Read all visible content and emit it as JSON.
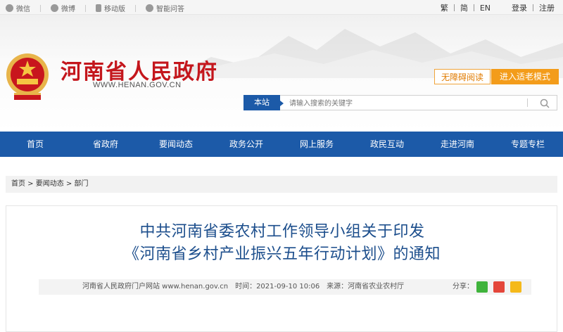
{
  "topbar": {
    "links": [
      "微信",
      "微博",
      "移动版",
      "智能问答"
    ],
    "lang": [
      "繁",
      "简",
      "EN"
    ],
    "login": "登录",
    "register": "注册"
  },
  "header": {
    "title": "河南省人民政府",
    "url": "WWW.HENAN.GOV.CN",
    "accessible": "无障碍阅读",
    "elder_mode": "进入适老模式"
  },
  "search": {
    "scope": "本站",
    "placeholder": "请输入搜索的关键字"
  },
  "nav": [
    "首页",
    "省政府",
    "要闻动态",
    "政务公开",
    "网上服务",
    "政民互动",
    "走进河南",
    "专题专栏"
  ],
  "breadcrumb": "首页 > 要闻动态 > 部门",
  "article": {
    "title_line1": "中共河南省委农村工作领导小组关于印发",
    "title_line2": "《河南省乡村产业振兴五年行动计划》的通知",
    "meta": "河南省人民政府门户网站 www.henan.gov.cn　时间：2021-09-10 10:06　来源：河南省农业农村厅",
    "share_label": "分享：",
    "share_icons": [
      "wechat-icon",
      "weibo-icon",
      "qzone-icon"
    ]
  },
  "colors": {
    "brand_red": "#c4161c",
    "nav_blue": "#1c5aa8",
    "title_blue": "#1c4e8c",
    "orange": "#f39c1a"
  }
}
